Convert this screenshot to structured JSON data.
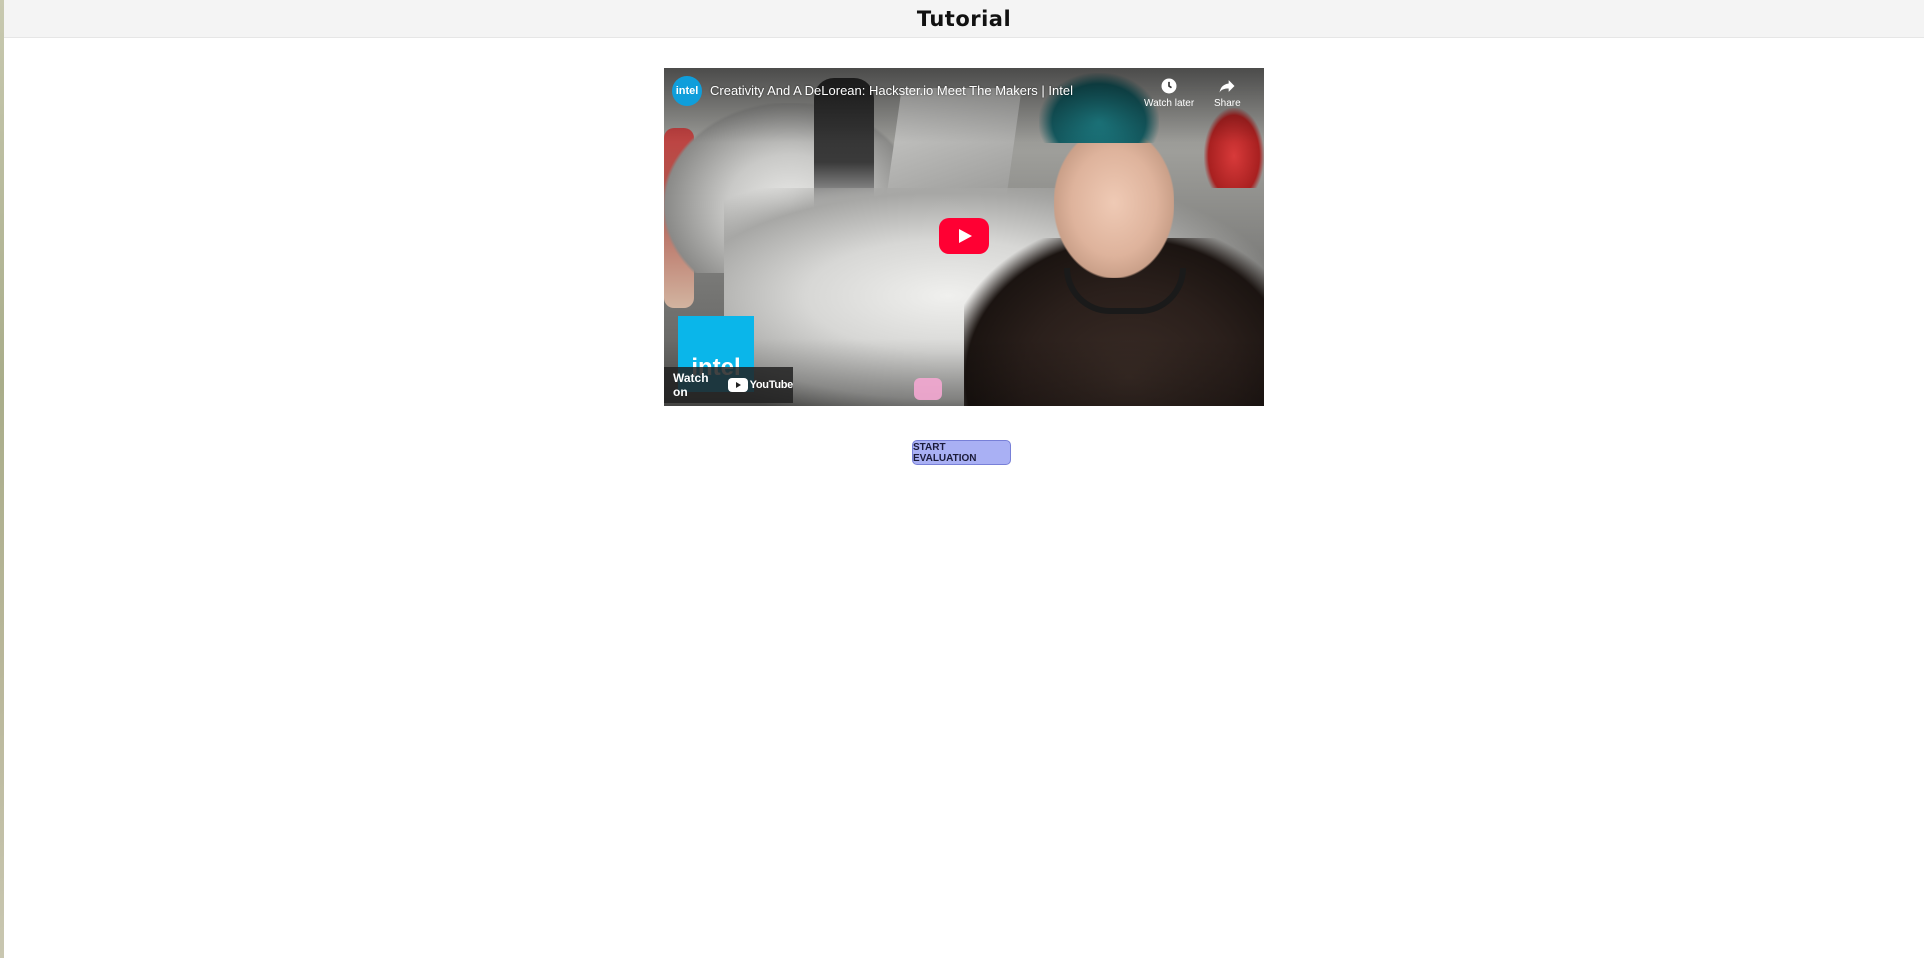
{
  "header": {
    "title": "Tutorial"
  },
  "video": {
    "channel_avatar_text": "intel",
    "title": "Creativity And A DeLorean: Hackster.io Meet The Makers | Intel",
    "watch_later_label": "Watch later",
    "share_label": "Share",
    "watch_on_label": "Watch on",
    "youtube_word": "YouTube",
    "brand_badge_text": "intel",
    "icons": {
      "watch_later": "clock-icon",
      "share": "share-arrow-icon",
      "play": "play-icon",
      "youtube": "youtube-logo-icon"
    }
  },
  "actions": {
    "start_label": "START EVALUATION"
  },
  "colors": {
    "header_bg": "#f4f4f4",
    "start_button_bg": "#a9b0f4",
    "play_red": "#ff0033",
    "intel_blue": "#0ab6ea"
  }
}
